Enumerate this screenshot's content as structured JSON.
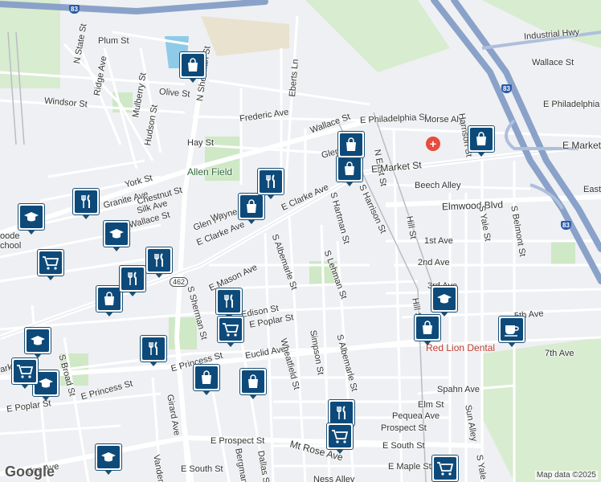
{
  "streets": [
    "Plum St",
    "N State St",
    "Ridge Ave",
    "Mulberry St",
    "N Sherman St",
    "Olive St",
    "Eberts Ln",
    "Windsor St",
    "Frederic Ave",
    "Hudson St",
    "Wallace St",
    "E Philadelphia St",
    "N East St",
    "Morse Aly",
    "Hay St",
    "Glen",
    "E Market St",
    "York St",
    "Granite Ave",
    "Chestnut St",
    "Silk Ave",
    "Wallace St",
    "Glen Pl",
    "Wayne",
    "E Clarke Ave",
    "E Clarke Ave",
    "S Hartman St",
    "S Harrison St",
    "Beech Alley",
    "Elmwood Blvd",
    "Hill St",
    "S Yale St",
    "S Belmont St",
    "1st Ave",
    "2nd Ave",
    "S Albemarle St",
    "S Lehman St",
    "E Mason Ave",
    "S Sherman St",
    "Edison St",
    "E Poplar St",
    "5th Ave",
    "7th Ave",
    "Euclid Ave",
    "S Broad St",
    "E Princess St",
    "E Princess St",
    "Girard Ave",
    "Wheatfield St",
    "Simpson St",
    "S Albemarle St",
    "Elm St",
    "Pequea Ave",
    "Prospect St",
    "E Prospect St",
    "E South St",
    "Spahn Ave",
    "Sun Alley",
    "E Poplar St",
    "Mt Rose Ave",
    "E Maple St",
    "Dallas St",
    "Bergman",
    "Vander",
    "E South St",
    "Ness Alley",
    "Industrial Hwy",
    "Wallace St",
    "E Philadelphia",
    "E Market",
    "East",
    "Hill St",
    "S Yale St",
    "Harrison St",
    "3rd Ave",
    "dge Ave",
    "arke"
  ],
  "places": {
    "park": "Allen Field",
    "dentist": "Red Lion Dental",
    "school": "oode\nchool"
  },
  "routes": {
    "top": "83",
    "right1": "83",
    "right2": "83",
    "state": "462"
  },
  "markers": [
    {
      "icon": "shopping-bag-icon"
    },
    {
      "icon": "shopping-bag-icon"
    },
    {
      "icon": "shopping-bag-icon"
    },
    {
      "icon": "shopping-bag-icon"
    },
    {
      "icon": "shopping-bag-icon"
    },
    {
      "icon": "restaurant-icon"
    },
    {
      "icon": "restaurant-icon"
    },
    {
      "icon": "restaurant-icon"
    },
    {
      "icon": "restaurant-icon"
    },
    {
      "icon": "school-icon"
    },
    {
      "icon": "school-icon"
    },
    {
      "icon": "school-icon"
    },
    {
      "icon": "shopping-cart-icon"
    },
    {
      "icon": "shopping-cart-icon"
    },
    {
      "icon": "shopping-cart-icon"
    },
    {
      "icon": "coffee-icon"
    }
  ],
  "attribution": "Map data ©2025",
  "logo": "Google"
}
